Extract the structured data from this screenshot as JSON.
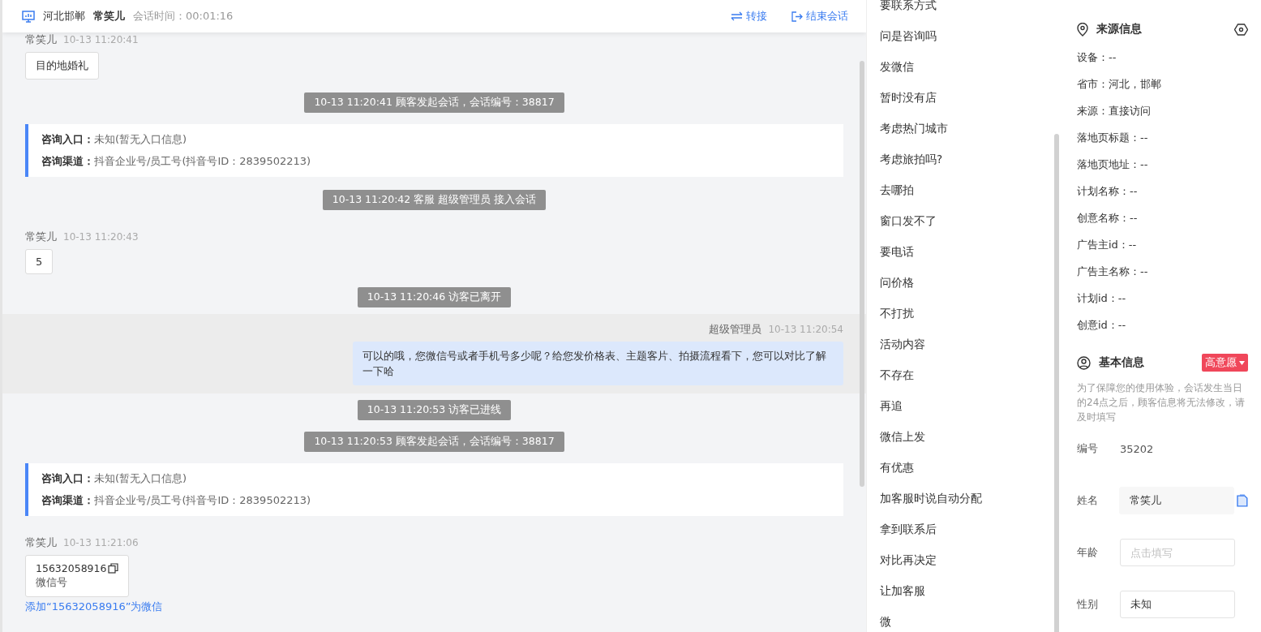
{
  "header": {
    "location": "河北邯郸",
    "visitor": "常笑儿",
    "timer_label": "会话时间：",
    "timer": "00:01:16",
    "actions": [
      {
        "label": "转接",
        "kind": "transfer"
      },
      {
        "label": "结束会话",
        "kind": "end"
      }
    ]
  },
  "messages": [
    {
      "kind": "incoming",
      "name": "常笑儿",
      "time": "10-13 11:20:41",
      "text": "目的地婚礼"
    },
    {
      "kind": "system",
      "text": "10-13 11:20:41 顾客发起会话，会话编号：38817"
    },
    {
      "kind": "info",
      "rows": [
        {
          "label": "咨询入口：",
          "value": "未知(暂无入口信息)"
        },
        {
          "label": "咨询渠道：",
          "value": "抖音企业号/员工号(抖音号ID：2839502213)"
        }
      ]
    },
    {
      "kind": "system",
      "text": "10-13 11:20:42 客服 超级管理员 接入会话"
    },
    {
      "kind": "incoming",
      "name": "常笑儿",
      "time": "10-13 11:20:43",
      "text": "5"
    },
    {
      "kind": "system",
      "text": "10-13 11:20:46 访客已离开"
    },
    {
      "kind": "outgoing",
      "name": "超级管理员",
      "time": "10-13 11:20:54",
      "text": "可以的哦，您微信号或者手机号多少呢？给您发价格表、主题客片、拍摄流程看下，您可以对比了解一下哈"
    },
    {
      "kind": "system",
      "text": "10-13 11:20:53 访客已进线"
    },
    {
      "kind": "system",
      "text": "10-13 11:20:53 顾客发起会话，会话编号：38817"
    },
    {
      "kind": "info",
      "rows": [
        {
          "label": "咨询入口：",
          "value": "未知(暂无入口信息)"
        },
        {
          "label": "咨询渠道：",
          "value": "抖音企业号/员工号(抖音号ID：2839502213)"
        }
      ]
    },
    {
      "kind": "contact",
      "name": "常笑儿",
      "time": "10-13 11:21:06",
      "number": "15632058916",
      "caption": "微信号",
      "link": "添加“15632058916”为微信"
    }
  ],
  "quick_replies": [
    "要联系方式",
    "问是咨询吗",
    "发微信",
    "暂时没有店",
    "考虑热门城市",
    "考虑旅拍吗?",
    "去哪拍",
    "窗口发不了",
    "要电话",
    "问价格",
    "不打扰",
    "活动内容",
    "不存在",
    "再追",
    "微信上发",
    "有优惠",
    "加客服时说自动分配",
    "拿到联系后",
    "对比再决定",
    "让加客服",
    "微"
  ],
  "source_info": {
    "title": "来源信息",
    "rows": [
      "设备：--",
      "省市：河北，邯郸",
      "来源：直接访问",
      "落地页标题：--",
      "落地页地址：--",
      "计划名称：--",
      "创意名称：--",
      "广告主id：--",
      "广告主名称：--",
      "计划id：--",
      "创意id：--"
    ]
  },
  "basic_info": {
    "title": "基本信息",
    "intent": "高意愿",
    "note": "为了保障您的使用体验，会话发生当日的24点之后，顾客信息将无法修改，请及时填写",
    "fields": [
      {
        "kind": "plain",
        "label": "编号",
        "value": "35202"
      },
      {
        "kind": "filled",
        "label": "姓名",
        "value": "常笑儿"
      },
      {
        "kind": "input",
        "label": "年龄",
        "placeholder": "点击填写"
      },
      {
        "kind": "input",
        "label": "性别",
        "value": "未知"
      }
    ]
  }
}
